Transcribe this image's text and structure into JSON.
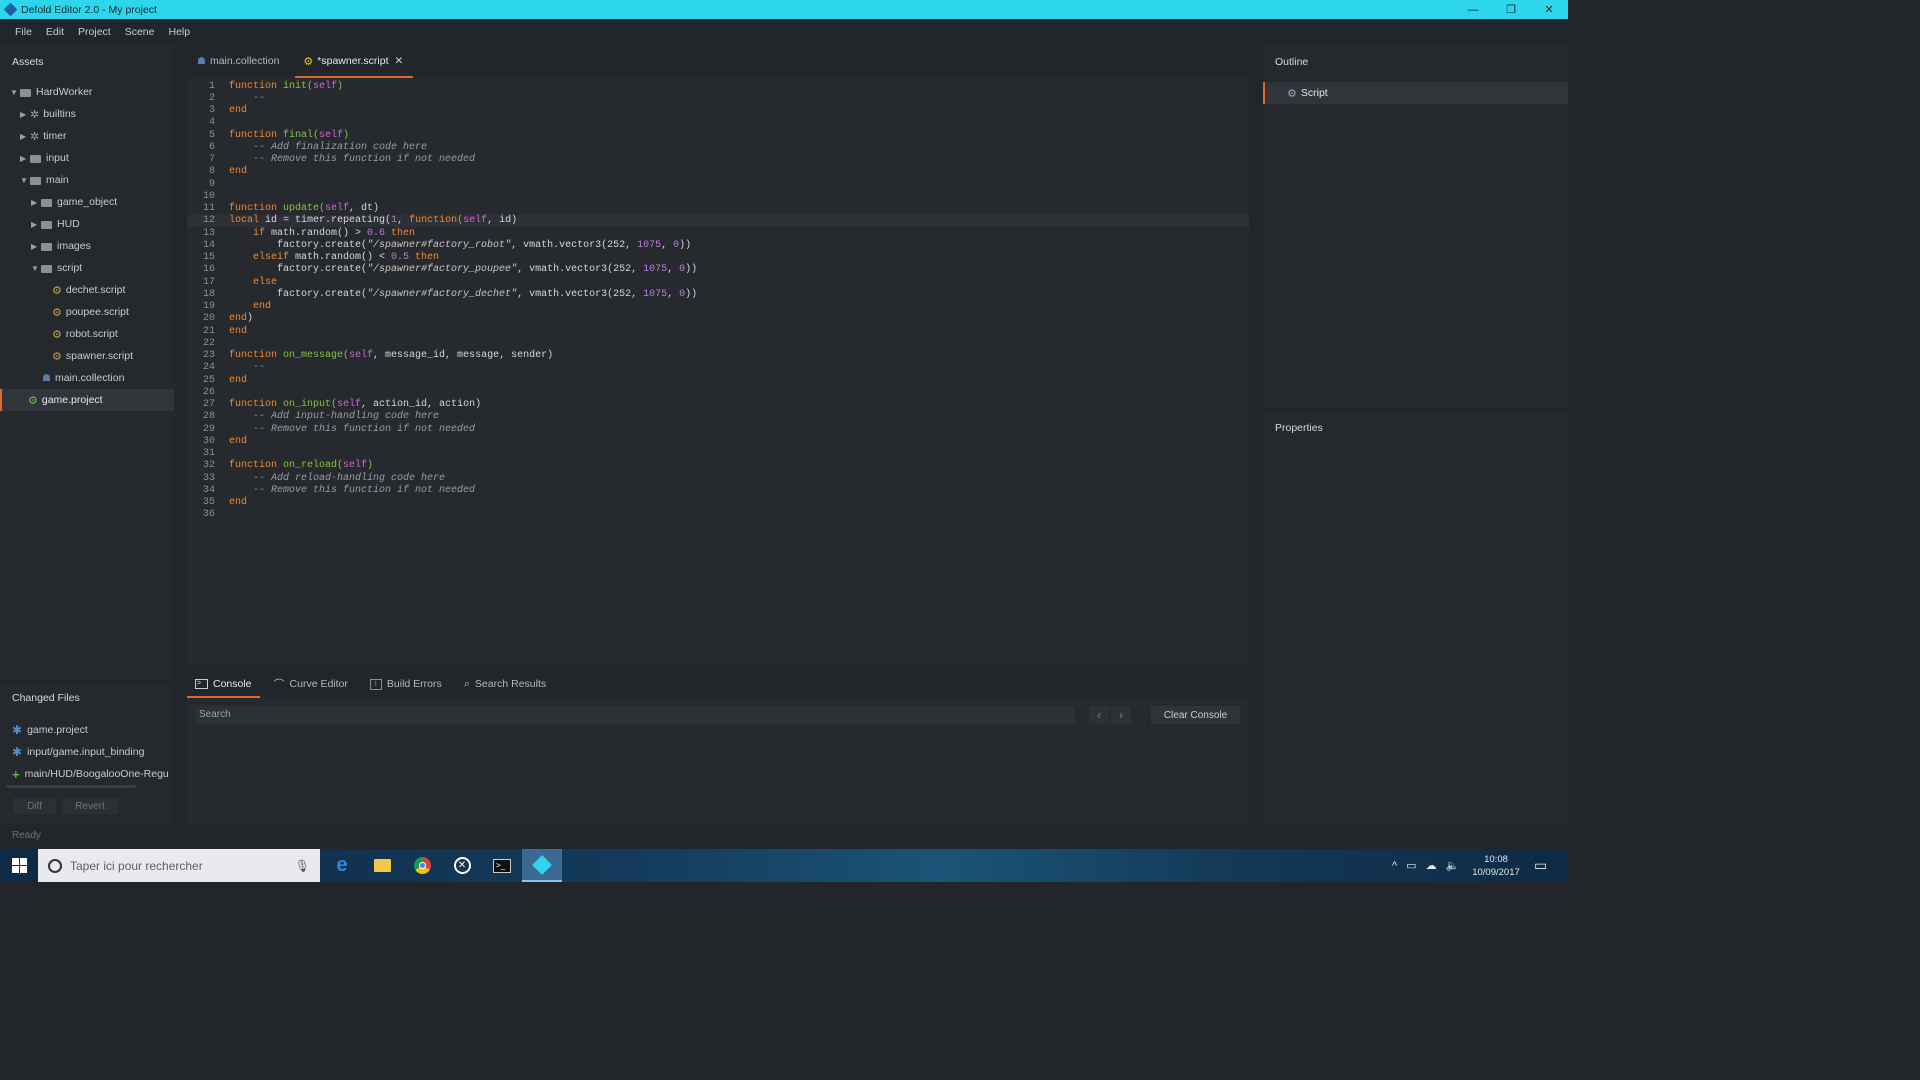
{
  "window": {
    "title": "Defold Editor 2.0 - My project",
    "min": "—",
    "max": "❐",
    "close": "✕"
  },
  "menu": [
    "File",
    "Edit",
    "Project",
    "Scene",
    "Help"
  ],
  "assets": {
    "title": "Assets",
    "items": [
      {
        "label": "HardWorker",
        "type": "folder",
        "open": true
      },
      {
        "label": "builtins",
        "type": "cog",
        "open": false
      },
      {
        "label": "timer",
        "type": "cog",
        "open": false
      },
      {
        "label": "input",
        "type": "folder",
        "open": false
      },
      {
        "label": "main",
        "type": "folder",
        "open": true
      },
      {
        "label": "game_object",
        "type": "folder",
        "open": false
      },
      {
        "label": "HUD",
        "type": "folder",
        "open": false
      },
      {
        "label": "images",
        "type": "folder",
        "open": false
      },
      {
        "label": "script",
        "type": "folder",
        "open": true
      },
      {
        "label": "dechet.script",
        "type": "script"
      },
      {
        "label": "poupee.script",
        "type": "script"
      },
      {
        "label": "robot.script",
        "type": "script"
      },
      {
        "label": "spawner.script",
        "type": "script"
      },
      {
        "label": "main.collection",
        "type": "collection"
      },
      {
        "label": "game.project",
        "type": "project",
        "selected": true
      }
    ]
  },
  "tabs": [
    {
      "label": "main.collection"
    },
    {
      "label": "*spawner.script",
      "close": "✕",
      "active": true
    }
  ],
  "code": [
    [
      [
        "kw",
        "function "
      ],
      [
        "fn",
        "init("
      ],
      [
        "sf",
        "self"
      ],
      [
        "fn",
        ")"
      ]
    ],
    [
      [
        "cm",
        "    --"
      ]
    ],
    [
      [
        "kw",
        "end"
      ]
    ],
    [],
    [
      [
        "kw",
        "function "
      ],
      [
        "fn",
        "final("
      ],
      [
        "sf",
        "self"
      ],
      [
        "fn",
        ")"
      ]
    ],
    [
      [
        "cm",
        "    -- Add finalization code here"
      ]
    ],
    [
      [
        "cm",
        "    -- Remove this function if not needed"
      ]
    ],
    [
      [
        "kw",
        "end"
      ]
    ],
    [],
    [],
    [
      [
        "kw",
        "function "
      ],
      [
        "fn",
        "update("
      ],
      [
        "sf",
        "self"
      ],
      [
        "op",
        ", dt)"
      ]
    ],
    [
      [
        "kw",
        "local "
      ],
      [
        "op",
        "id = timer.repeating("
      ],
      [
        "num",
        "1"
      ],
      [
        "op",
        ", "
      ],
      [
        "kw",
        "function"
      ],
      [
        "fn",
        "("
      ],
      [
        "sf",
        "self"
      ],
      [
        "op",
        ", id)"
      ]
    ],
    [
      [
        "kw",
        "    if "
      ],
      [
        "op",
        "math.random() > "
      ],
      [
        "num",
        "0.6"
      ],
      [
        "kw",
        " then"
      ]
    ],
    [
      [
        "op",
        "        factory.create("
      ],
      [
        "str",
        "\"/spawner#factory_robot\""
      ],
      [
        "op",
        ", vmath.vector3(252, "
      ],
      [
        "num",
        "1075"
      ],
      [
        "op",
        ", "
      ],
      [
        "num",
        "0"
      ],
      [
        "op",
        "))"
      ]
    ],
    [
      [
        "kw",
        "    elseif "
      ],
      [
        "op",
        "math.random() < "
      ],
      [
        "num",
        "0.5"
      ],
      [
        "kw",
        " then"
      ]
    ],
    [
      [
        "op",
        "        factory.create("
      ],
      [
        "str",
        "\"/spawner#factory_poupee\""
      ],
      [
        "op",
        ", vmath.vector3(252, "
      ],
      [
        "num",
        "1075"
      ],
      [
        "op",
        ", "
      ],
      [
        "num",
        "0"
      ],
      [
        "op",
        "))"
      ]
    ],
    [
      [
        "kw",
        "    else"
      ]
    ],
    [
      [
        "op",
        "        factory.create("
      ],
      [
        "str",
        "\"/spawner#factory_dechet\""
      ],
      [
        "op",
        ", vmath.vector3(252, "
      ],
      [
        "num",
        "1075"
      ],
      [
        "op",
        ", "
      ],
      [
        "num",
        "0"
      ],
      [
        "op",
        "))"
      ]
    ],
    [
      [
        "kw",
        "    end"
      ]
    ],
    [
      [
        "kw",
        "end"
      ],
      [
        "op",
        ")"
      ]
    ],
    [
      [
        "kw",
        "end"
      ]
    ],
    [],
    [
      [
        "kw",
        "function "
      ],
      [
        "fn",
        "on_message("
      ],
      [
        "sf",
        "self"
      ],
      [
        "op",
        ", message_id, message, sender)"
      ]
    ],
    [
      [
        "cm",
        "    --"
      ]
    ],
    [
      [
        "kw",
        "end"
      ]
    ],
    [],
    [
      [
        "kw",
        "function "
      ],
      [
        "fn",
        "on_input("
      ],
      [
        "sf",
        "self"
      ],
      [
        "op",
        ", action_id, action)"
      ]
    ],
    [
      [
        "cm",
        "    -- Add input-handling code here"
      ]
    ],
    [
      [
        "cm",
        "    -- Remove this function if not needed"
      ]
    ],
    [
      [
        "kw",
        "end"
      ]
    ],
    [],
    [
      [
        "kw",
        "function "
      ],
      [
        "fn",
        "on_reload("
      ],
      [
        "sf",
        "self"
      ],
      [
        "fn",
        ")"
      ]
    ],
    [
      [
        "cm",
        "    -- Add reload-handling code here"
      ]
    ],
    [
      [
        "cm",
        "    -- Remove this function if not needed"
      ]
    ],
    [
      [
        "kw",
        "end"
      ]
    ],
    []
  ],
  "outline": {
    "title": "Outline",
    "item": "Script"
  },
  "properties": {
    "title": "Properties"
  },
  "bottom": {
    "tabs": [
      "Console",
      "Curve Editor",
      "Build Errors",
      "Search Results"
    ],
    "search_placeholder": "Search",
    "clear": "Clear Console",
    "prev": "‹",
    "next": "›"
  },
  "changed": {
    "title": "Changed Files",
    "items": [
      {
        "label": "game.project",
        "type": "modified"
      },
      {
        "label": "input/game.input_binding",
        "type": "modified"
      },
      {
        "label": "main/HUD/BoogalooOne-Regu",
        "type": "added"
      }
    ],
    "diff": "Diff",
    "revert": "Revert"
  },
  "status": "Ready",
  "taskbar": {
    "search": "Taper ici pour rechercher",
    "time": "10:08",
    "date": "10/09/2017"
  }
}
